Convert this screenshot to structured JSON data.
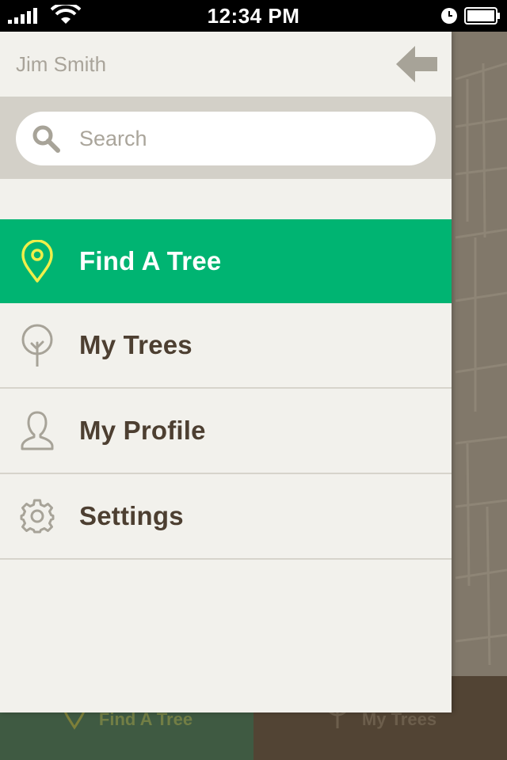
{
  "status_bar": {
    "time": "12:34 PM"
  },
  "drawer": {
    "user_name": "Jim Smith",
    "search": {
      "placeholder": "Search",
      "value": ""
    },
    "menu": [
      {
        "label": "Find A Tree",
        "icon": "map-pin-icon",
        "active": true
      },
      {
        "label": "My Trees",
        "icon": "tree-icon",
        "active": false
      },
      {
        "label": "My Profile",
        "icon": "person-icon",
        "active": false
      },
      {
        "label": "Settings",
        "icon": "gear-icon",
        "active": false
      }
    ]
  },
  "background_tabbar": {
    "tabs": [
      {
        "label": "Find A Tree",
        "icon": "map-pin-icon"
      },
      {
        "label": "My Trees",
        "icon": "tree-icon"
      }
    ]
  },
  "colors": {
    "accent_green": "#00b472",
    "drawer_bg": "#f2f1ec",
    "search_band": "#d3d0c8",
    "menu_text": "#4d3f31",
    "pin_yellow": "#f0ef4a",
    "icon_gray": "#a7a398"
  }
}
